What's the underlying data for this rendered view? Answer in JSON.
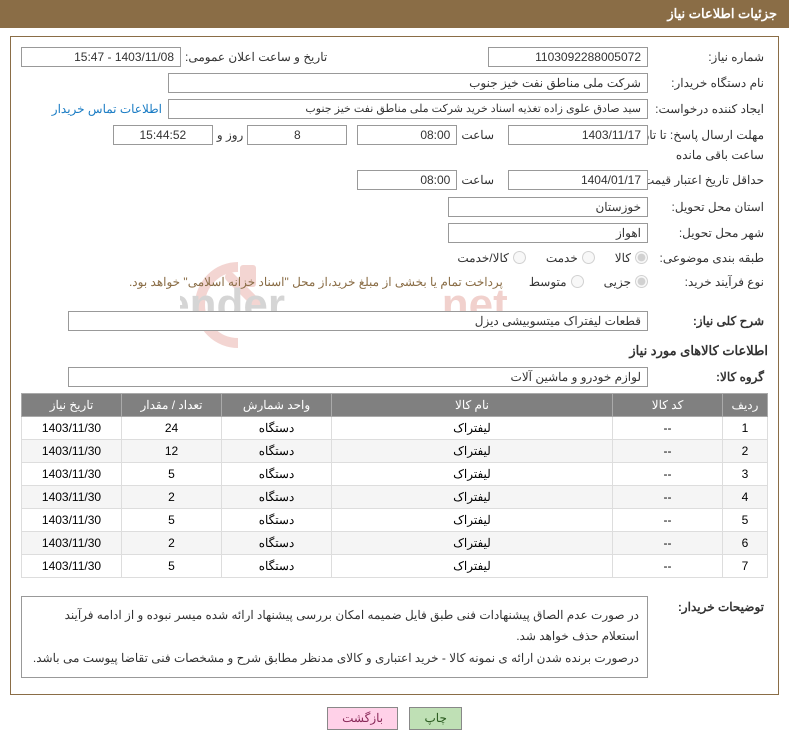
{
  "header": {
    "title": "جزئیات اطلاعات نیاز"
  },
  "fields": {
    "need_number_label": "شماره نیاز:",
    "need_number": "1103092288005072",
    "public_announce_label": "تاریخ و ساعت اعلان عمومی:",
    "public_announce": "1403/11/08 - 15:47",
    "buyer_org_label": "نام دستگاه خریدار:",
    "buyer_org": "شرکت ملی مناطق نفت خیز جنوب",
    "requester_label": "ایجاد کننده درخواست:",
    "requester": "سید صادق علوی زاده  تغذیه اسناد خرید  شرکت ملی مناطق نفت خیز جنوب",
    "buyer_contact_link": "اطلاعات تماس خریدار",
    "response_deadline_label": "مهلت ارسال پاسخ: تا تاریخ:",
    "response_deadline_date": "1403/11/17",
    "time_label": "ساعت",
    "response_deadline_time": "08:00",
    "days_label": "روز و",
    "days_remaining": "8",
    "countdown": "15:44:52",
    "remaining_label": "ساعت باقی مانده",
    "price_validity_label": "حداقل تاریخ اعتبار قیمت: تا تاریخ:",
    "price_validity_date": "1404/01/17",
    "price_validity_time": "08:00",
    "delivery_province_label": "استان محل تحویل:",
    "delivery_province": "خوزستان",
    "delivery_city_label": "شهر محل تحویل:",
    "delivery_city": "اهواز",
    "category_label": "طبقه بندی موضوعی:",
    "cat_goods": "کالا",
    "cat_service": "خدمت",
    "cat_goods_service": "کالا/خدمت",
    "process_type_label": "نوع فرآیند خرید:",
    "proc_small": "جزیی",
    "proc_medium": "متوسط",
    "payment_note": "پرداخت تمام یا بخشی از مبلغ خرید،از محل \"اسناد خزانه اسلامی\" خواهد بود.",
    "summary_label": "شرح کلی نیاز:",
    "summary": "قطعات لیفتراک میتسوبیشی دیزل",
    "items_section_title": "اطلاعات کالاهای مورد نیاز",
    "goods_group_label": "گروه کالا:",
    "goods_group": "لوازم خودرو و ماشین آلات",
    "buyer_notes_label": "توضیحات خریدار:",
    "buyer_notes_line1": "در صورت عدم الصاق پیشنهادات فنی طبق فایل ضمیمه امکان بررسی پیشنهاد ارائه شده میسر نبوده و از ادامه فرآیند استعلام حذف خواهد شد.",
    "buyer_notes_line2": "درصورت برنده شدن ارائه ی نمونه کالا - خرید اعتباری و کالای مدنظر مطابق شرح و مشخصات فنی تقاضا پیوست می باشد."
  },
  "table": {
    "headers": {
      "row": "ردیف",
      "code": "کد کالا",
      "name": "نام کالا",
      "unit": "واحد شمارش",
      "qty": "تعداد / مقدار",
      "date": "تاریخ نیاز"
    },
    "rows": [
      {
        "n": "1",
        "code": "--",
        "name": "لیفتراک",
        "unit": "دستگاه",
        "qty": "24",
        "date": "1403/11/30"
      },
      {
        "n": "2",
        "code": "--",
        "name": "لیفتراک",
        "unit": "دستگاه",
        "qty": "12",
        "date": "1403/11/30"
      },
      {
        "n": "3",
        "code": "--",
        "name": "لیفتراک",
        "unit": "دستگاه",
        "qty": "5",
        "date": "1403/11/30"
      },
      {
        "n": "4",
        "code": "--",
        "name": "لیفتراک",
        "unit": "دستگاه",
        "qty": "2",
        "date": "1403/11/30"
      },
      {
        "n": "5",
        "code": "--",
        "name": "لیفتراک",
        "unit": "دستگاه",
        "qty": "5",
        "date": "1403/11/30"
      },
      {
        "n": "6",
        "code": "--",
        "name": "لیفتراک",
        "unit": "دستگاه",
        "qty": "2",
        "date": "1403/11/30"
      },
      {
        "n": "7",
        "code": "--",
        "name": "لیفتراک",
        "unit": "دستگاه",
        "qty": "5",
        "date": "1403/11/30"
      }
    ]
  },
  "buttons": {
    "print": "چاپ",
    "back": "بازگشت"
  },
  "watermark_text": "AriaTender.net"
}
